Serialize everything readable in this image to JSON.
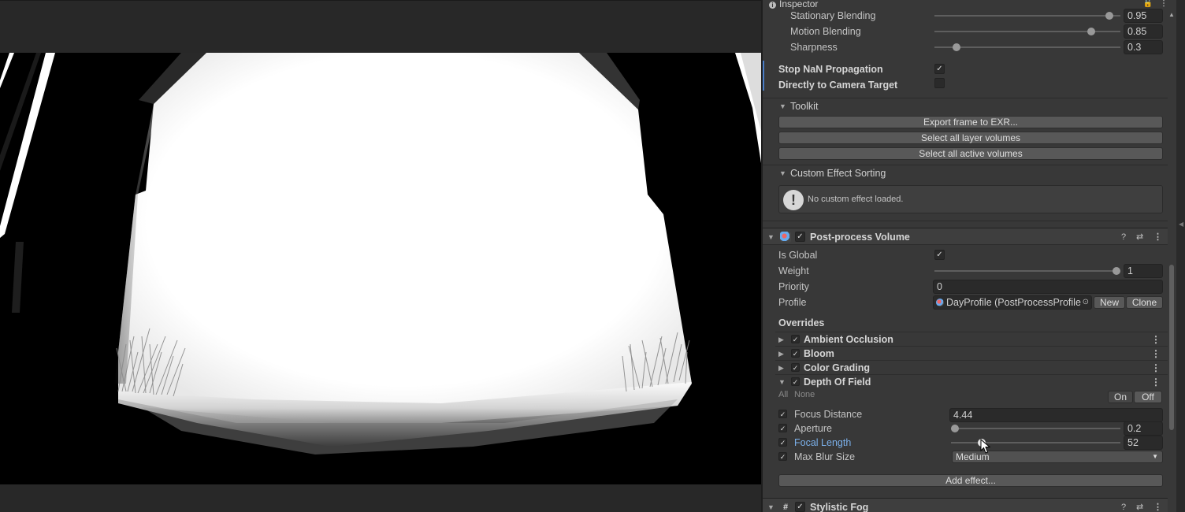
{
  "scene": {
    "description_hidden": ""
  },
  "inspector": {
    "tab_label": "Inspector",
    "tab_icons": [
      "lock-icon",
      "kebab-menu-icon"
    ],
    "rows_top": [
      {
        "label": "Stationary Blending",
        "value": "0.95",
        "fraction": 0.95
      },
      {
        "label": "Motion Blending",
        "value": "0.85",
        "fraction": 0.85
      },
      {
        "label": "Sharpness",
        "value": "0.3",
        "fraction": 0.12
      }
    ],
    "stop_nan": {
      "label": "Stop NaN Propagation",
      "checked": "✓"
    },
    "direct_cam": {
      "label": "Directly to Camera Target",
      "checked": ""
    },
    "toolkit": {
      "title": "Toolkit",
      "buttons": [
        "Export frame to EXR...",
        "Select all layer volumes",
        "Select all active volumes"
      ]
    },
    "custom_sorting": {
      "title": "Custom Effect Sorting",
      "message": "No custom effect loaded.",
      "icon": "!"
    },
    "ppv": {
      "title": "Post-process Volume",
      "enabled": "✓",
      "is_global": {
        "label": "Is Global",
        "checked": "✓"
      },
      "weight": {
        "label": "Weight",
        "value": "1",
        "fraction": 1.0
      },
      "priority": {
        "label": "Priority",
        "value": "0"
      },
      "profile": {
        "label": "Profile",
        "value": "DayProfile (PostProcessProfile)",
        "new_label": "New",
        "clone_label": "Clone"
      },
      "overrides_label": "Overrides",
      "overrides": [
        {
          "name": "Ambient Occlusion",
          "expanded": false,
          "enabled": "✓"
        },
        {
          "name": "Bloom",
          "expanded": false,
          "enabled": "✓"
        },
        {
          "name": "Color Grading",
          "expanded": false,
          "enabled": "✓"
        },
        {
          "name": "Depth Of Field",
          "expanded": true,
          "enabled": "✓"
        }
      ],
      "all_label": "All",
      "none_label": "None",
      "on_label": "On",
      "off_label": "Off",
      "dof": {
        "focus_distance": {
          "label": "Focus Distance",
          "value": "4.44"
        },
        "aperture": {
          "label": "Aperture",
          "value": "0.2",
          "fraction": 0.0
        },
        "focal_length": {
          "label": "Focal Length",
          "value": "52",
          "fraction": 0.17
        },
        "max_blur": {
          "label": "Max Blur Size",
          "value": "Medium"
        }
      },
      "add_effect": "Add effect..."
    },
    "stylistic_fog": {
      "title": "Stylistic Fog",
      "enabled": "✓"
    }
  },
  "colors": {
    "panel_bg": "#383838",
    "accent_blue": "#7bb0ea",
    "scene_bg": "#000000"
  }
}
